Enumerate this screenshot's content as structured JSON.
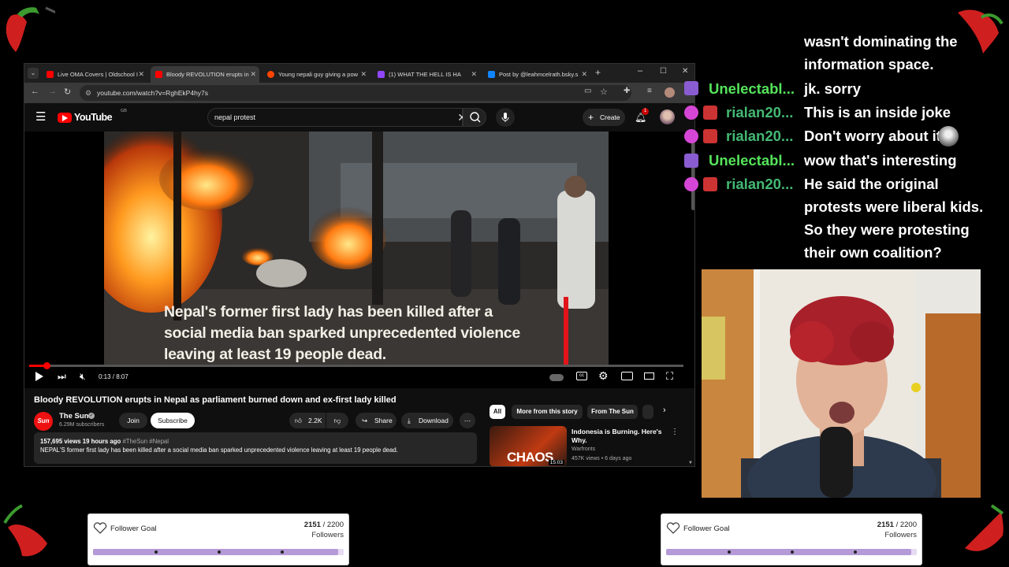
{
  "colors": {
    "accent_red": "#ff0000",
    "chat_green": "#55e35a",
    "chat_teal": "#44b873",
    "goal_fill": "#b49ad6"
  },
  "chat_overflow": {
    "line1": "wasn't dominating the",
    "line2": "information space."
  },
  "chat": [
    {
      "user": "Unelectabl...",
      "message": "jk. sorry",
      "badge": "sub-badge-icon"
    },
    {
      "user": "rialan20...",
      "message": "This is an inside joke",
      "badge": "gift-badge-icon"
    },
    {
      "user": "rialan20...",
      "message": "Don't worry about it",
      "badge": "gift-badge-icon"
    },
    {
      "user": "Unelectabl...",
      "message": "wow that's interesting",
      "badge": "sub-badge-icon"
    },
    {
      "user": "rialan20...",
      "message": "He said the original",
      "badge": "gift-badge-icon"
    }
  ],
  "chat_continued": [
    "protests were liberal kids.",
    "So they were protesting",
    "their own coalition?"
  ],
  "browser": {
    "tabs": [
      {
        "title": "Live OMA Covers | Oldschool I",
        "fav": "#ff0000"
      },
      {
        "title": "Bloody REVOLUTION erupts in",
        "fav": "#ff0000"
      },
      {
        "title": "Young nepali guy giving a pow",
        "fav": "#ff4500"
      },
      {
        "title": "(1) WHAT THE HELL IS HA",
        "fav": "#9146ff"
      },
      {
        "title": "Post by @leahmcelrath.bsky.s",
        "fav": "#1185fe"
      }
    ],
    "url": "youtube.com/watch?v=RghEkP4hy7s"
  },
  "youtube": {
    "logo": "YouTube",
    "logo_sup": "GB",
    "search_value": "nepal protest",
    "create_label": "Create",
    "notif_count": "1",
    "caption_lines": [
      "Nepal's former first lady has been killed after a",
      "social media ban sparked unprecedented violence",
      "leaving at least 19 people dead."
    ],
    "time": "0:13 / 8:07",
    "progress": 0.027,
    "title": "Bloody REVOLUTION erupts in Nepal as parliament burned down and ex-first lady killed",
    "channel": "The Sun",
    "channel_logo": "Sun",
    "subscribers": "6.29M subscribers",
    "join": "Join",
    "subscribe": "Subscribe",
    "likes": "2.2K",
    "share": "Share",
    "download": "Download",
    "views_line": "157,695 views  19 hours ago",
    "hashtags": "#TheSun #Nepal",
    "description": "NEPAL'S former first lady has been killed after a social media ban sparked unprecedented violence leaving at least 19 people dead.",
    "chips": [
      "All",
      "More from this story",
      "From The Sun"
    ],
    "rec": {
      "title_line1": "Indonesia is Burning. Here's",
      "title_line2": "Why.",
      "channel": "Warfronts",
      "meta": "457K views • 6 days ago",
      "thumb_text": "CHAOS",
      "duration": "15:03"
    }
  },
  "goals": [
    {
      "label": "Follower Goal",
      "current": "2151",
      "target": "2200",
      "sub": "Followers",
      "progress": 0.978
    },
    {
      "label": "Follower Goal",
      "current": "2151",
      "target": "2200",
      "sub": "Followers",
      "progress": 0.978
    }
  ]
}
